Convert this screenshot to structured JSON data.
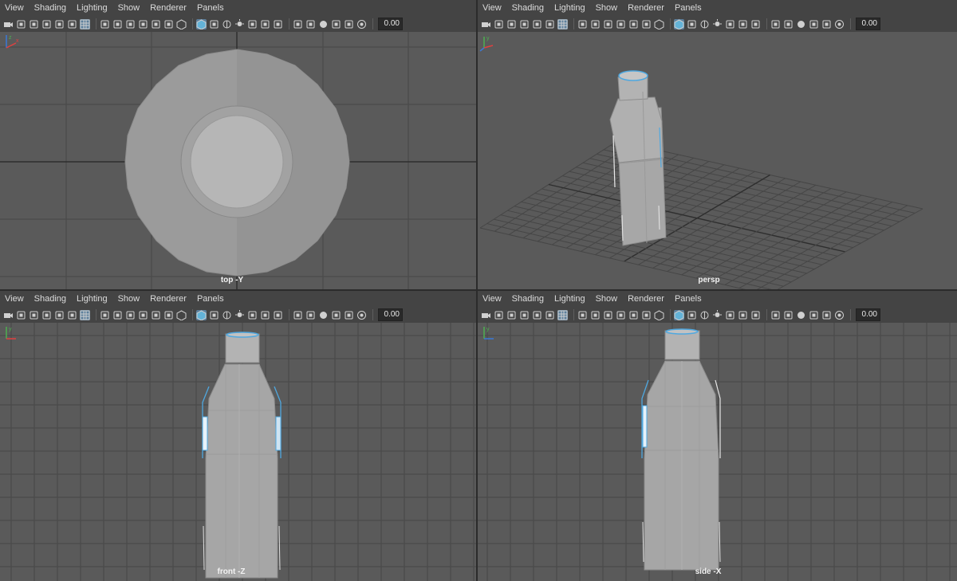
{
  "menu": [
    "View",
    "Shading",
    "Lighting",
    "Show",
    "Renderer",
    "Panels"
  ],
  "toolbar": {
    "icons": [
      "select-camera-icon",
      "camera-attributes-icon",
      "bookmark-icon",
      "image-plane-icon",
      "two-d-pan-icon",
      "grease-pencil-icon",
      "grid-icon",
      "film-gate-icon",
      "resolution-gate-icon",
      "gate-mask-icon",
      "field-chart-icon",
      "safe-action-icon",
      "safe-title-icon",
      "wireframe-icon",
      "smooth-shade-icon",
      "default-material-icon",
      "xray-icon",
      "use-lights-icon",
      "shadows-icon",
      "screen-space-ao-icon",
      "motion-blur-icon",
      "multisample-aa-icon",
      "depth-of-field-icon",
      "isolate-select-icon",
      "xray-joints-icon",
      "xray-active-icon",
      "exposure-icon"
    ],
    "exposure_value": "0.00"
  },
  "panels": {
    "top": {
      "camera": "top -Y"
    },
    "persp": {
      "camera": "persp"
    },
    "front": {
      "camera": "front -Z"
    },
    "side": {
      "camera": "side -X"
    }
  },
  "colors": {
    "viewport_bg": "#5a5a5a",
    "grid": "#474747",
    "grid_axis": "#2e2e2e",
    "active_blue": "#5c7f9c",
    "highlight": "#4fa8e0"
  }
}
